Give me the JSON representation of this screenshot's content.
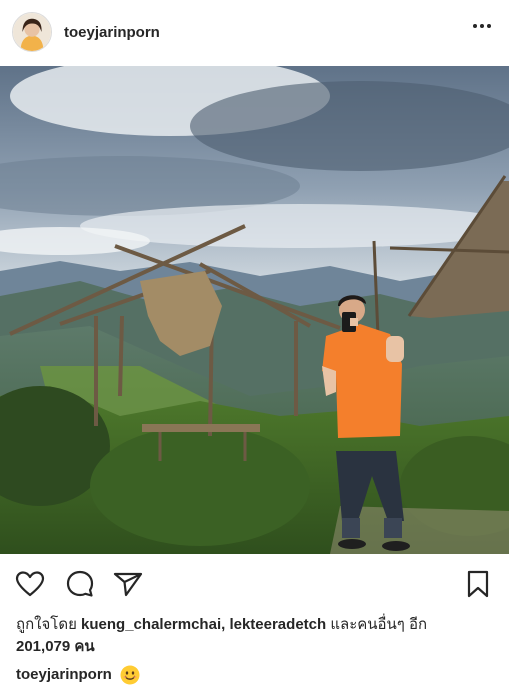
{
  "post": {
    "username": "toeyjarinporn",
    "avatar_icon": "profile-photo-avatar",
    "more_icon": "more-options-icon",
    "photo_alt": "Man in orange shirt taking a mirror photo next to a bamboo hut on a mountain viewpoint"
  },
  "actions": {
    "like_icon": "heart-icon",
    "comment_icon": "comment-icon",
    "share_icon": "share-icon",
    "save_icon": "bookmark-icon"
  },
  "likes": {
    "prefix": "ถูกใจโดย ",
    "users": "kueng_chalermchai, lekteeradetch",
    "suffix": " และคนอื่นๆ อีก",
    "count_text": "201,079 คน"
  },
  "caption": {
    "username": "toeyjarinporn",
    "emoji": "smiling-face-emoji"
  },
  "colors": {
    "text": "#262626",
    "border": "#dbdbdb",
    "shirt": "#f47f2c"
  }
}
